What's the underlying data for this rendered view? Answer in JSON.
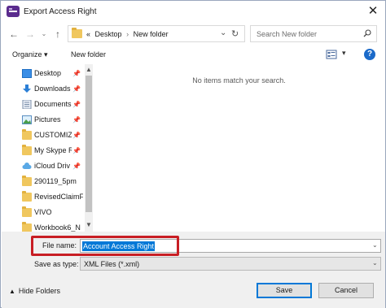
{
  "window": {
    "title": "Export Access Right",
    "close_label": "✕"
  },
  "address_bar": {
    "overflow_label": "«",
    "crumbs": [
      "Desktop",
      "New folder"
    ],
    "separator": "›"
  },
  "search": {
    "placeholder": "Search New folder"
  },
  "toolbar": {
    "organize_label": "Organize ▾",
    "new_folder_label": "New folder",
    "help_label": "?"
  },
  "nav_pane": {
    "items": [
      {
        "label": "Desktop",
        "icon": "desktop-icon",
        "pinned": true
      },
      {
        "label": "Downloads",
        "icon": "downloads-icon",
        "pinned": true
      },
      {
        "label": "Documents",
        "icon": "documents-icon",
        "pinned": true
      },
      {
        "label": "Pictures",
        "icon": "pictures-icon",
        "pinned": true
      },
      {
        "label": "CUSTOMIZ",
        "icon": "folder-icon",
        "pinned": true
      },
      {
        "label": "My Skype R",
        "icon": "folder-icon",
        "pinned": true
      },
      {
        "label": "iCloud Driv",
        "icon": "icloud-icon",
        "pinned": true
      },
      {
        "label": "290119_5pm",
        "icon": "folder-icon",
        "pinned": false
      },
      {
        "label": "RevisedClaimF",
        "icon": "folder-icon",
        "pinned": false
      },
      {
        "label": "VIVO",
        "icon": "folder-icon",
        "pinned": false
      },
      {
        "label": "Workbook6_N",
        "icon": "folder-icon",
        "pinned": false
      }
    ]
  },
  "file_list": {
    "empty_message": "No items match your search."
  },
  "form": {
    "file_name_label": "File name:",
    "file_name_value": "Account Access Right",
    "save_as_type_label": "Save as type:",
    "save_as_type_value": "XML Files (*.xml)"
  },
  "footer": {
    "hide_folders_label": "Hide Folders",
    "save_label": "Save",
    "cancel_label": "Cancel"
  },
  "colors": {
    "selection": "#0078d7",
    "highlight_annotation": "#c81e24",
    "folder": "#f0c75e",
    "help": "#1b6ac9"
  }
}
